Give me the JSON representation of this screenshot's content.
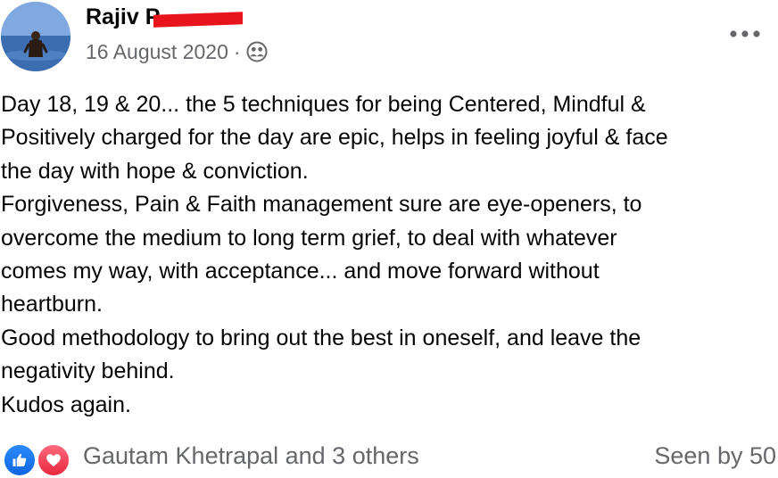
{
  "post": {
    "author": {
      "name": "Rajiv P"
    },
    "date": "16 August 2020",
    "separator": "·",
    "audience_icon": "friends-icon",
    "more_icon": "more-options-icon",
    "body_lines": [
      "Day 18, 19 & 20... the 5 techniques for being Centered, Mindful &",
      "Positively charged for the day are epic, helps in feeling joyful & face",
      "the day with hope & conviction.",
      "Forgiveness, Pain & Faith management sure are eye-openers, to",
      "overcome the medium to long term grief, to deal with whatever",
      "comes my way, with acceptance... and move forward without",
      "heartburn.",
      "Good methodology to bring out the best in oneself, and leave the",
      "negativity behind.",
      "Kudos again."
    ],
    "reactions": {
      "icons": [
        "like-icon",
        "love-icon"
      ],
      "text": "Gautam Khetrapal and 3 others"
    },
    "seen_by": "Seen by 50",
    "colors": {
      "text_primary": "#050505",
      "text_secondary": "#65676b",
      "like_blue": "#1877f2",
      "love_red": "#f33e58",
      "redaction_red": "#e8141c"
    }
  }
}
